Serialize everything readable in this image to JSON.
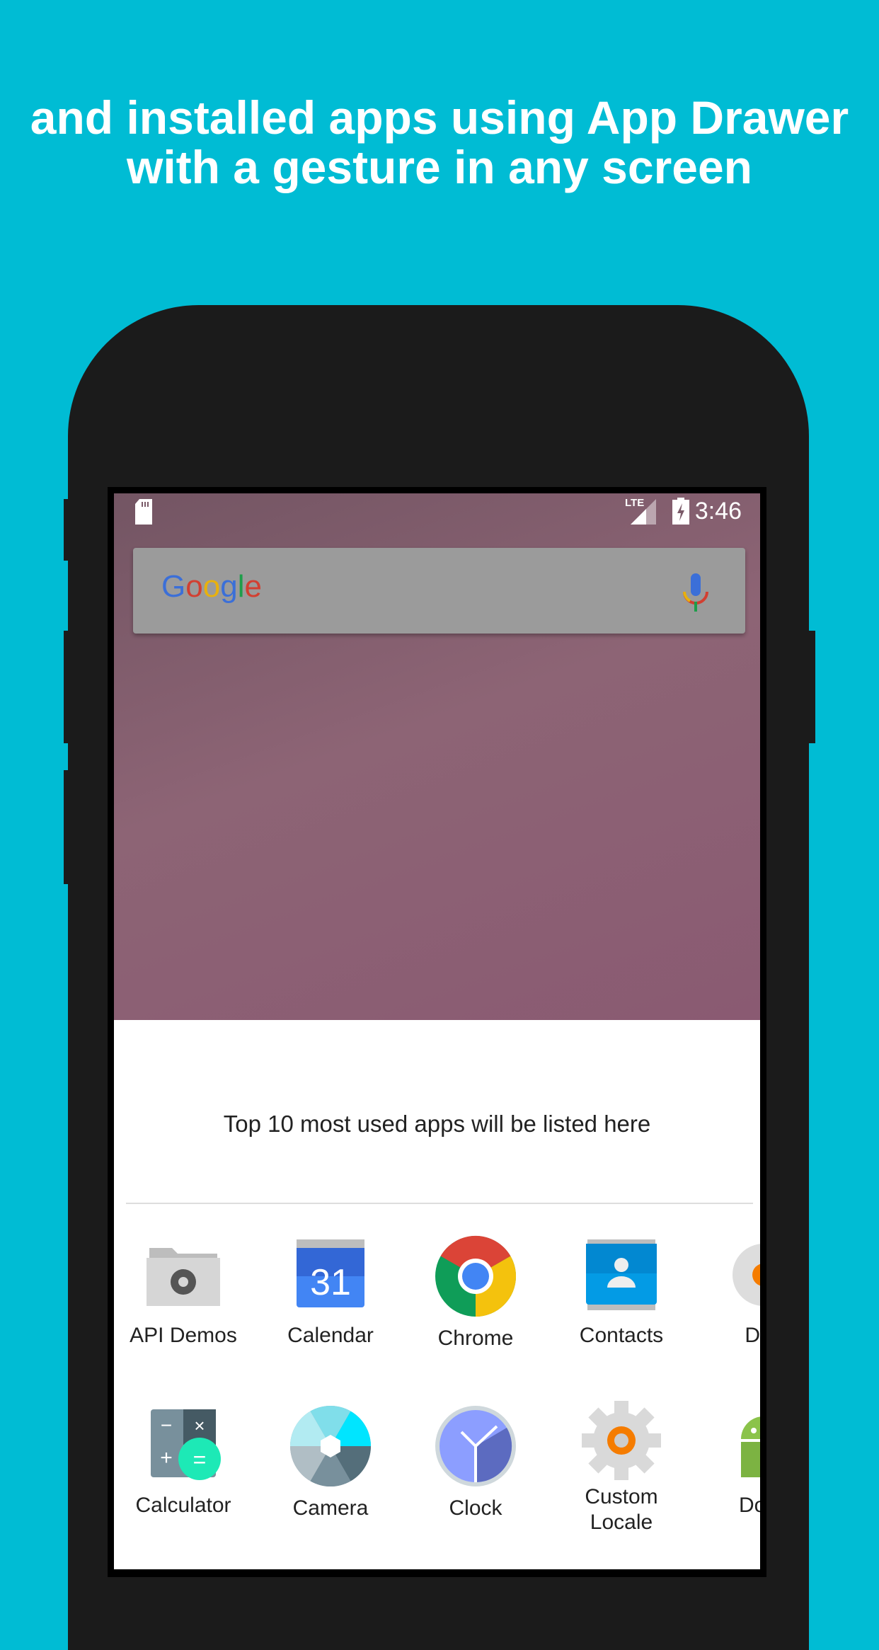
{
  "headline": [
    "and installed apps using App Drawer",
    "with a gesture in any screen"
  ],
  "status_bar": {
    "time": "3:46",
    "network": "LTE",
    "icons": [
      "sd-card-icon",
      "lte-signal-icon",
      "battery-charging-icon"
    ]
  },
  "search_widget": {
    "logo": "Google",
    "mic_icon": "microphone-icon"
  },
  "drawer": {
    "hint": "Top 10 most used apps will be listed here",
    "apps": [
      {
        "label": "API Demos",
        "icon": "api-demos-icon"
      },
      {
        "label": "Calendar",
        "icon": "calendar-icon",
        "day": "31"
      },
      {
        "label": "Chrome",
        "icon": "chrome-icon"
      },
      {
        "label": "Contacts",
        "icon": "contacts-icon"
      },
      {
        "label": "Dev",
        "icon": "dev-settings-icon"
      },
      {
        "label": "Calculator",
        "icon": "calculator-icon"
      },
      {
        "label": "Camera",
        "icon": "camera-icon"
      },
      {
        "label": "Clock",
        "icon": "clock-icon"
      },
      {
        "label": "Custom Locale",
        "icon": "custom-locale-icon"
      },
      {
        "label": "Docu",
        "icon": "android-icon"
      }
    ]
  },
  "colors": {
    "background": "#00BCD4",
    "phone": "#1b1b1b"
  }
}
